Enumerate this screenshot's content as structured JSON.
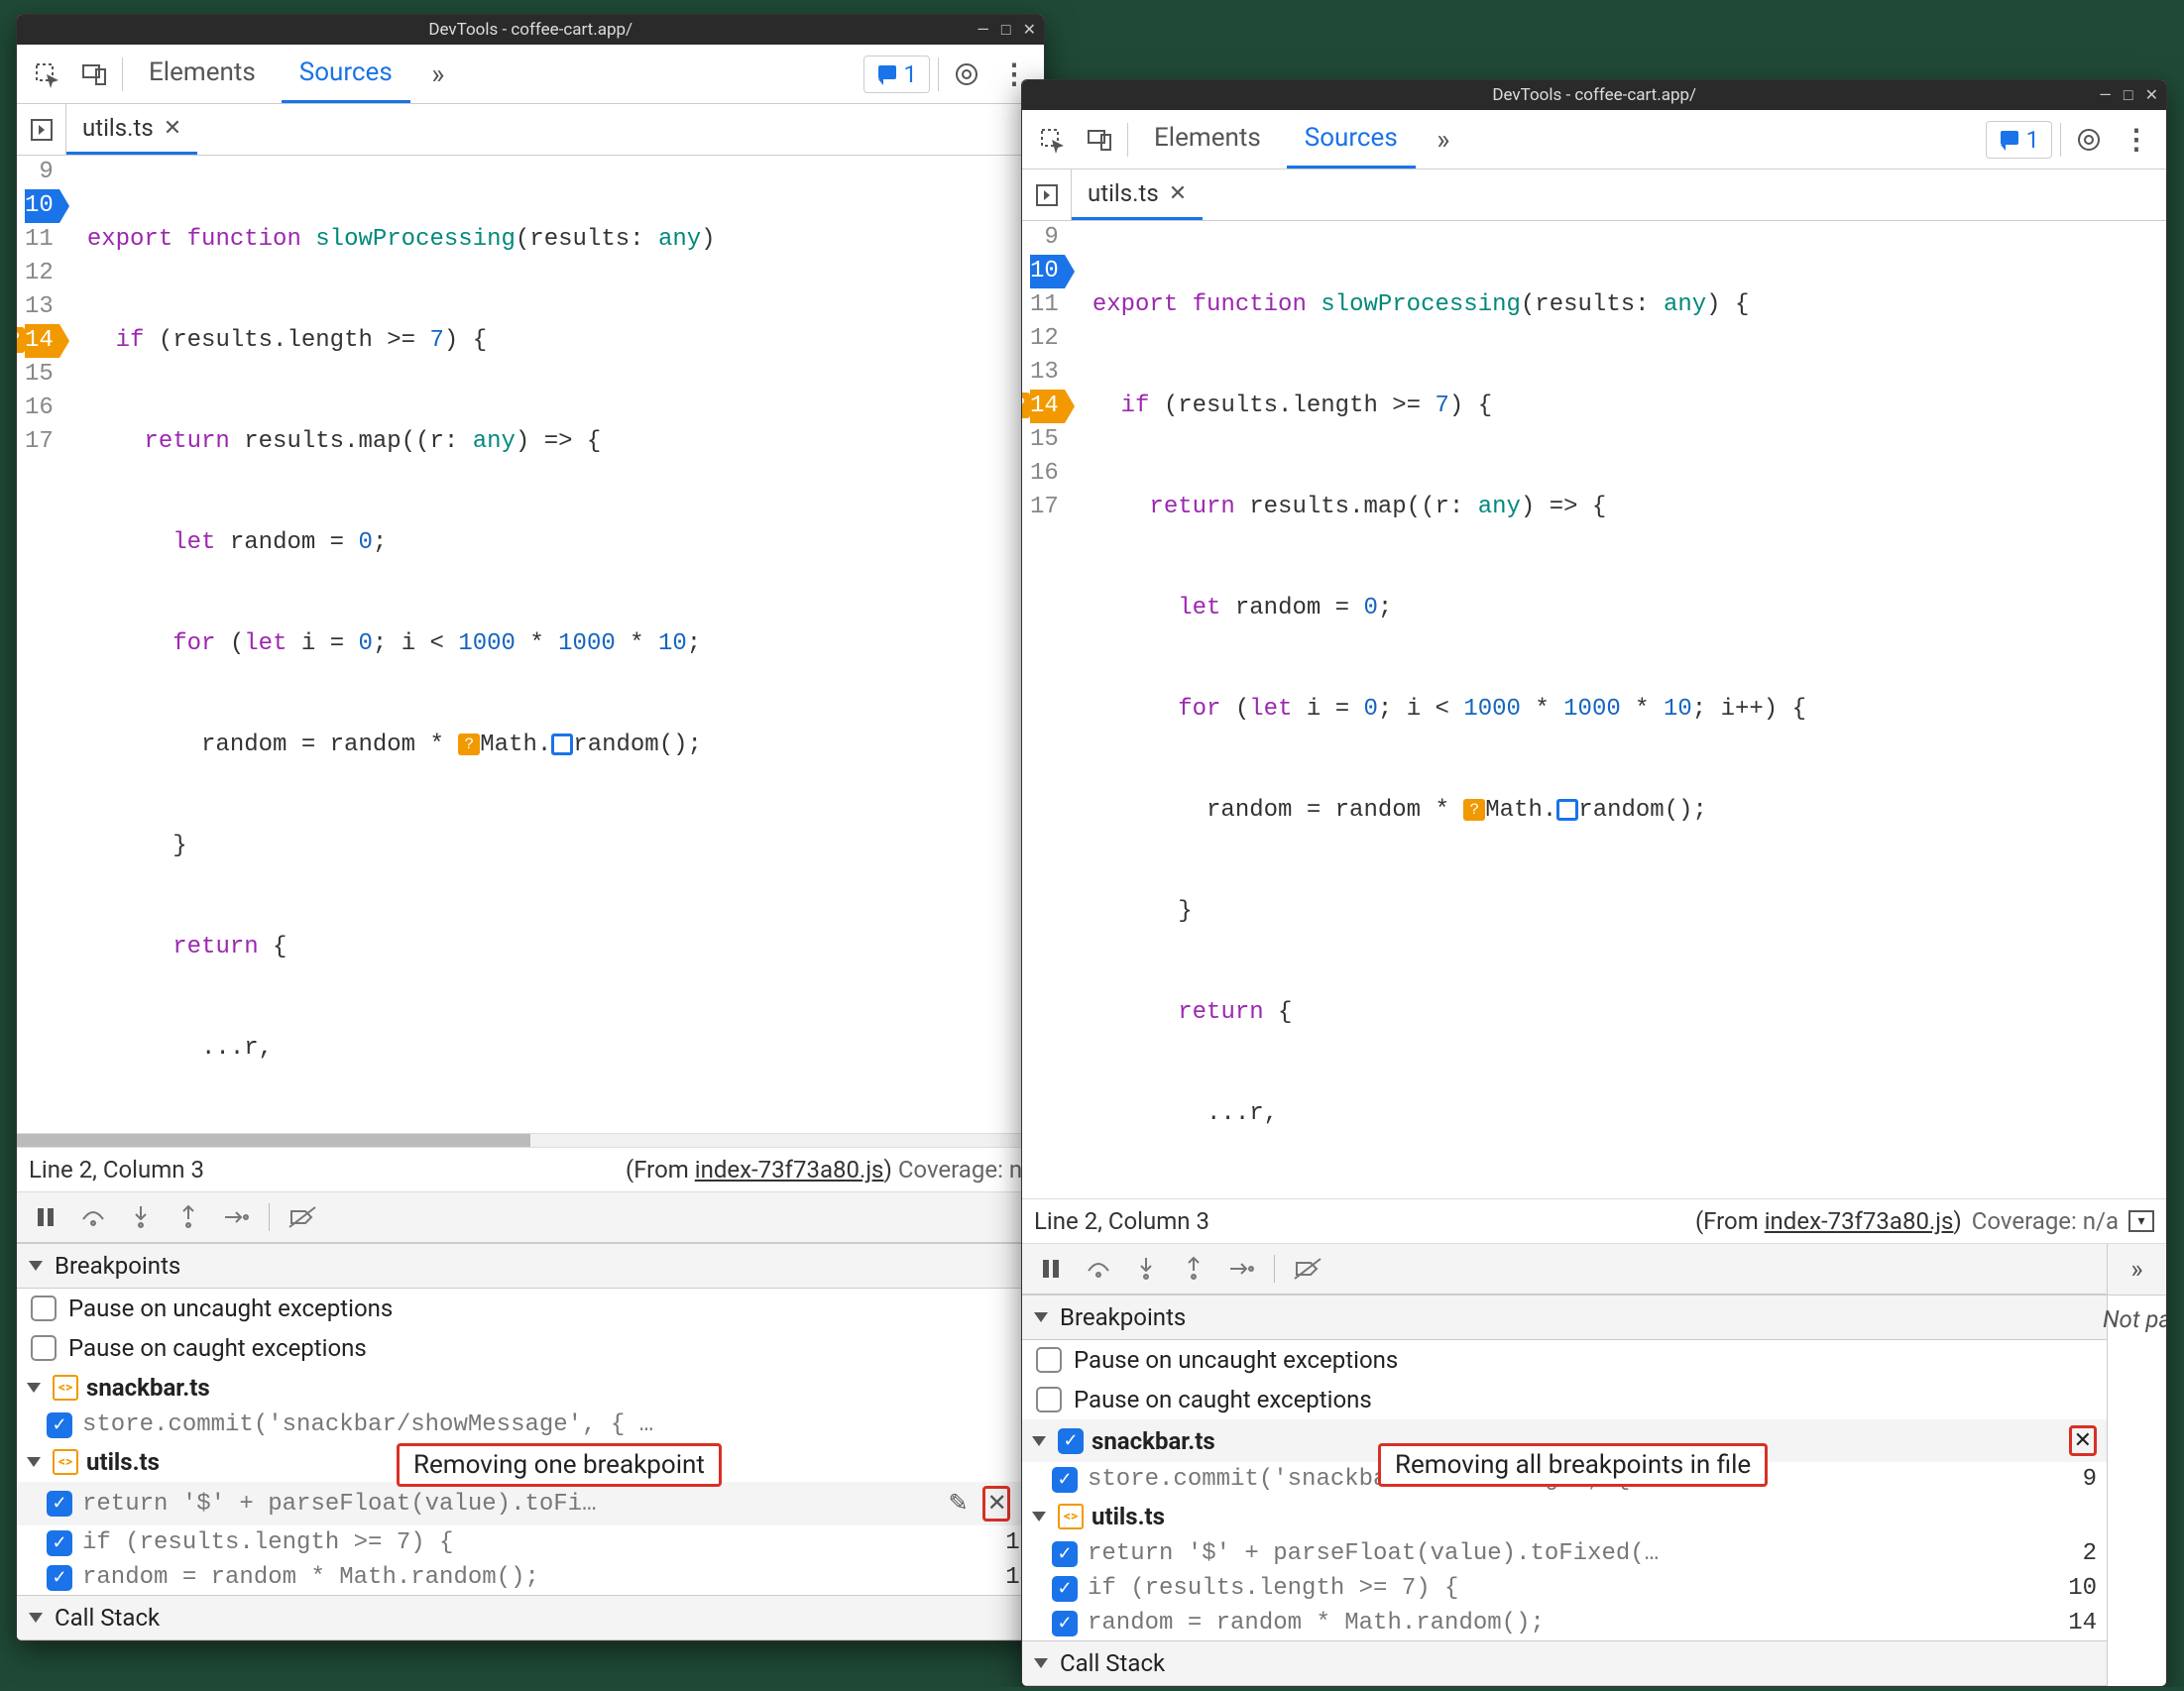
{
  "title": "DevTools - coffee-cart.app/",
  "tabs": {
    "elements": "Elements",
    "sources": "Sources"
  },
  "badge_count": "1",
  "filetab": "utils.ts",
  "code": {
    "lines": [
      {
        "n": "9",
        "cls": ""
      },
      {
        "n": "10",
        "cls": "blue"
      },
      {
        "n": "11",
        "cls": ""
      },
      {
        "n": "12",
        "cls": ""
      },
      {
        "n": "13",
        "cls": ""
      },
      {
        "n": "14",
        "cls": "orange"
      },
      {
        "n": "15",
        "cls": ""
      },
      {
        "n": "16",
        "cls": ""
      },
      {
        "n": "17",
        "cls": ""
      }
    ]
  },
  "status": {
    "pos": "Line 2, Column 3",
    "from_prefix": "(From ",
    "from_file": "index-73f73a80.js",
    "from_suffix": ")",
    "coverage_short": "Coverage: n/",
    "coverage_full": "Coverage: n/a"
  },
  "sections": {
    "breakpoints": "Breakpoints",
    "callstack": "Call Stack"
  },
  "pause": {
    "uncaught": "Pause on uncaught exceptions",
    "caught": "Pause on caught exceptions"
  },
  "groups": {
    "snackbar": "snackbar.ts",
    "utils": "utils.ts",
    "snackbar_bp": {
      "code": "store.commit('snackbar/showMessage', { …",
      "line": "9"
    },
    "utils_bp1": {
      "code": "return '$' + parseFloat(value).toFi…",
      "code_long": "return '$' + parseFloat(value).toFixed(…",
      "line": "2"
    },
    "utils_bp2": {
      "code": "if (results.length >= 7) {",
      "line": "10"
    },
    "utils_bp3": {
      "code": "random = random * Math.random();",
      "line": "14"
    }
  },
  "right_panel": "Not pa",
  "captions": {
    "left": "Removing one breakpoint",
    "right": "Removing all breakpoints in file"
  }
}
